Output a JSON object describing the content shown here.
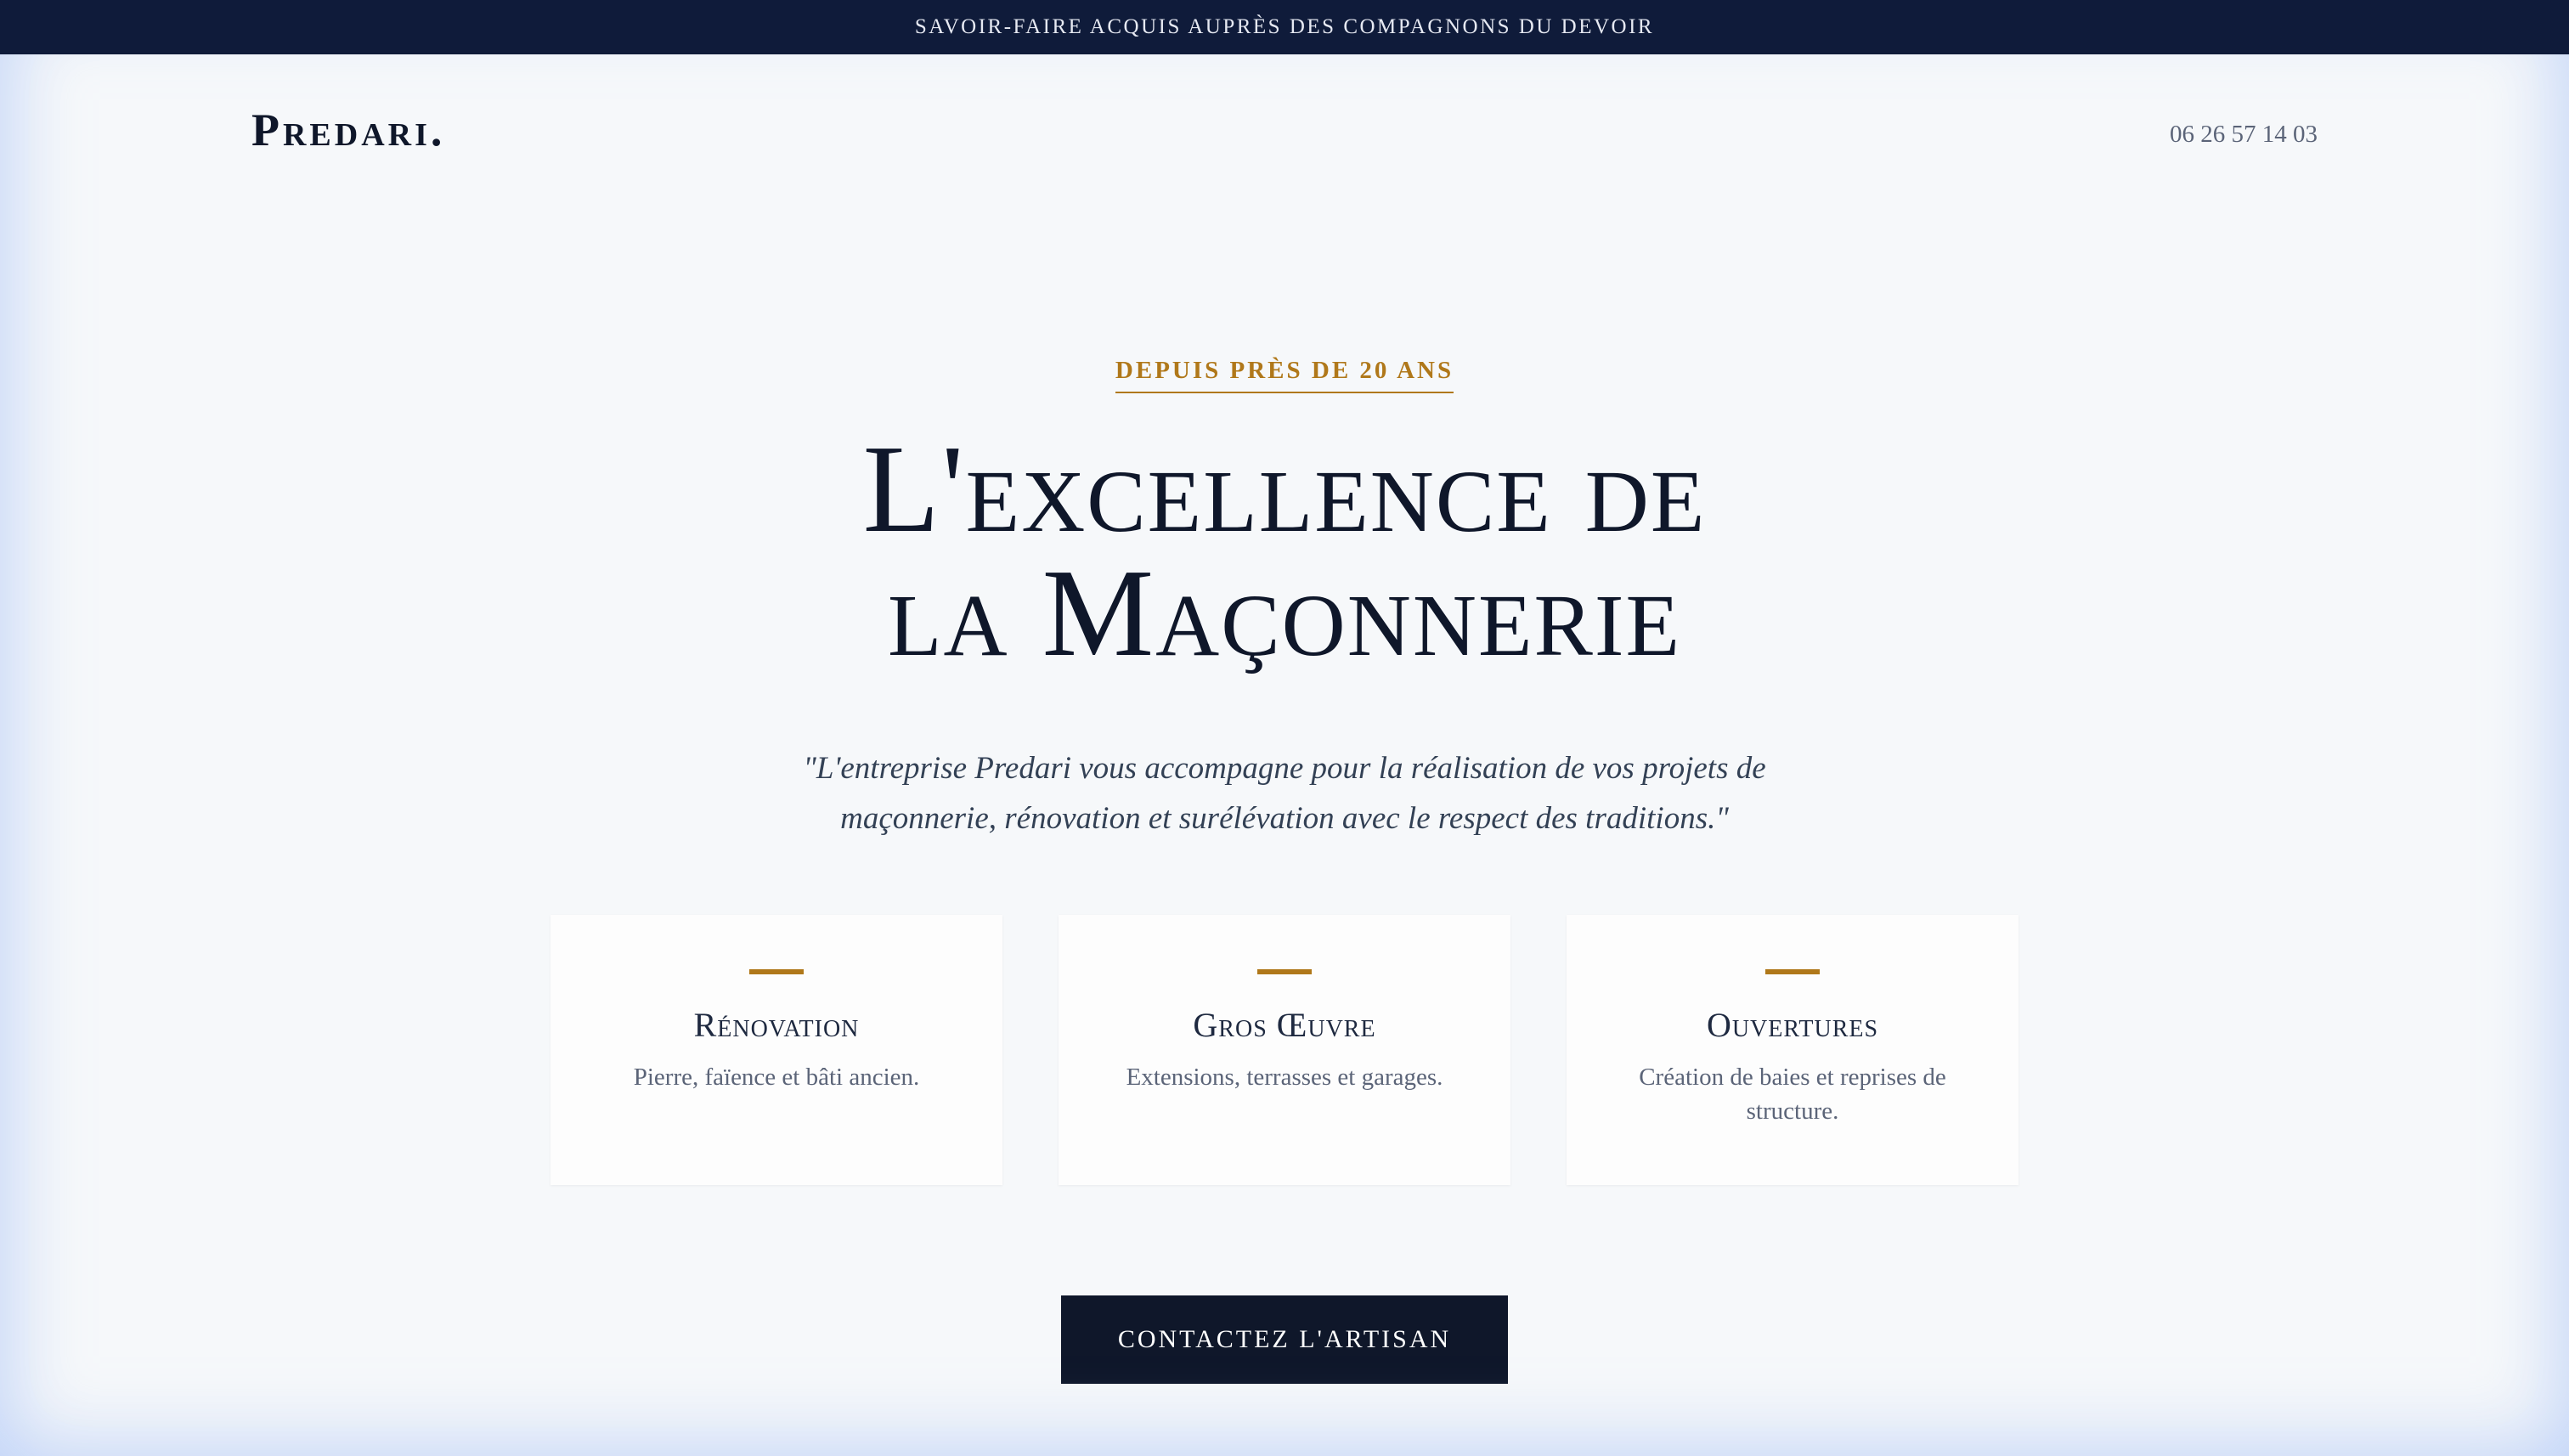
{
  "announcement": {
    "text": "SAVOIR-FAIRE ACQUIS AUPRÈS DES COMPAGNONS DU DEVOIR"
  },
  "header": {
    "logo": "Predari.",
    "phone": "06 26 57 14 03"
  },
  "hero": {
    "eyebrow": "DEPUIS PRÈS DE 20 ANS",
    "title_line1": "L'excellence de",
    "title_line2": "la Maçonnerie",
    "quote": "\"L'entreprise Predari vous accompagne pour la réalisation de vos projets de maçonnerie, rénovation et surélévation avec le respect des traditions.\""
  },
  "services": [
    {
      "title": "Rénovation",
      "description": "Pierre, faïence et bâti ancien."
    },
    {
      "title": "Gros Œuvre",
      "description": "Extensions, terrasses et garages."
    },
    {
      "title": "Ouvertures",
      "description": "Création de baies et reprises de structure."
    }
  ],
  "cta": {
    "label": "CONTACTEZ L'ARTISAN"
  },
  "colors": {
    "navy": "#0f172a",
    "topbar": "#0f1b3a",
    "gold": "#b0781a",
    "background": "#f6f8fa",
    "muted_text": "#5b6478"
  }
}
